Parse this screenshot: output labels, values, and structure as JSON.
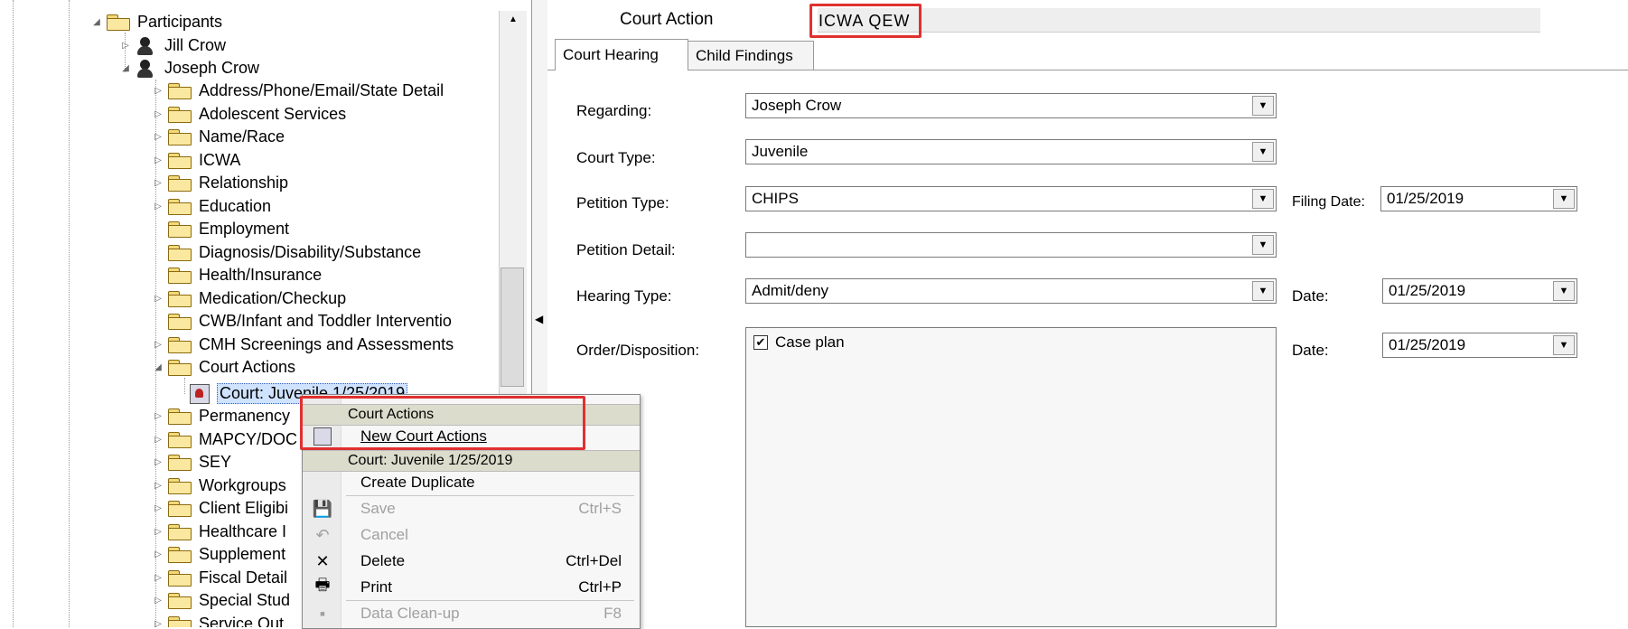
{
  "tree": {
    "root_label": "Participants",
    "people": [
      {
        "label": "Jill Crow"
      },
      {
        "label": "Joseph Crow"
      }
    ],
    "folders": [
      "Address/Phone/Email/State Detail",
      "Adolescent Services",
      "Name/Race",
      "ICWA",
      "Relationship",
      "Education",
      "Employment",
      "Diagnosis/Disability/Substance",
      "Health/Insurance",
      "Medication/Checkup",
      "CWB/Infant and Toddler Interventio",
      "CMH Screenings and Assessments",
      "Court Actions"
    ],
    "court_item": "Court: Juvenile 1/25/2019",
    "folders_after": [
      "Permanency",
      "MAPCY/DOC",
      "SEY",
      "Workgroups",
      "Client Eligibi",
      "Healthcare I",
      "Supplement",
      "Fiscal Detail",
      "Special Stud",
      "Service Out"
    ]
  },
  "header": {
    "title": "Court Action",
    "badge": "ICWA QEW"
  },
  "tabs": [
    {
      "label": "Court Hearing",
      "active": true
    },
    {
      "label": "Child Findings",
      "active": false
    }
  ],
  "form": {
    "regarding": {
      "label": "Regarding:",
      "value": "Joseph Crow"
    },
    "court_type": {
      "label": "Court Type:",
      "value": "Juvenile"
    },
    "petition_type": {
      "label": "Petition Type:",
      "value": "CHIPS"
    },
    "filing_date": {
      "label": "Filing Date:",
      "value": "01/25/2019"
    },
    "petition_detail": {
      "label": "Petition Detail:",
      "value": ""
    },
    "hearing_type": {
      "label": "Hearing Type:",
      "value": "Admit/deny"
    },
    "hearing_date": {
      "label": "Date:",
      "value": "01/25/2019"
    },
    "order_disposition": {
      "label": "Order/Disposition:",
      "options": [
        {
          "label": "Case plan",
          "checked": true
        }
      ]
    },
    "order_date": {
      "label": "Date:",
      "value": "01/25/2019"
    }
  },
  "context_menu": {
    "section1": "Court Actions",
    "new_court_actions": "New Court Actions",
    "section2": "Court: Juvenile 1/25/2019",
    "items": [
      {
        "label": "Create Duplicate",
        "shortcut": "",
        "enabled": true,
        "icon": ""
      },
      {
        "label": "Save",
        "shortcut": "Ctrl+S",
        "enabled": false,
        "icon": "save-icon"
      },
      {
        "label": "Cancel",
        "shortcut": "",
        "enabled": false,
        "icon": "undo-icon"
      },
      {
        "label": "Delete",
        "shortcut": "Ctrl+Del",
        "enabled": true,
        "icon": "delete-x-icon"
      },
      {
        "label": "Print",
        "shortcut": "Ctrl+P",
        "enabled": true,
        "icon": "printer-icon"
      },
      {
        "label": "Data Clean-up",
        "shortcut": "F8",
        "enabled": false,
        "icon": "cleanup-icon"
      }
    ]
  },
  "colors": {
    "highlight": "#e03030",
    "selection": "#cfe3ff"
  }
}
